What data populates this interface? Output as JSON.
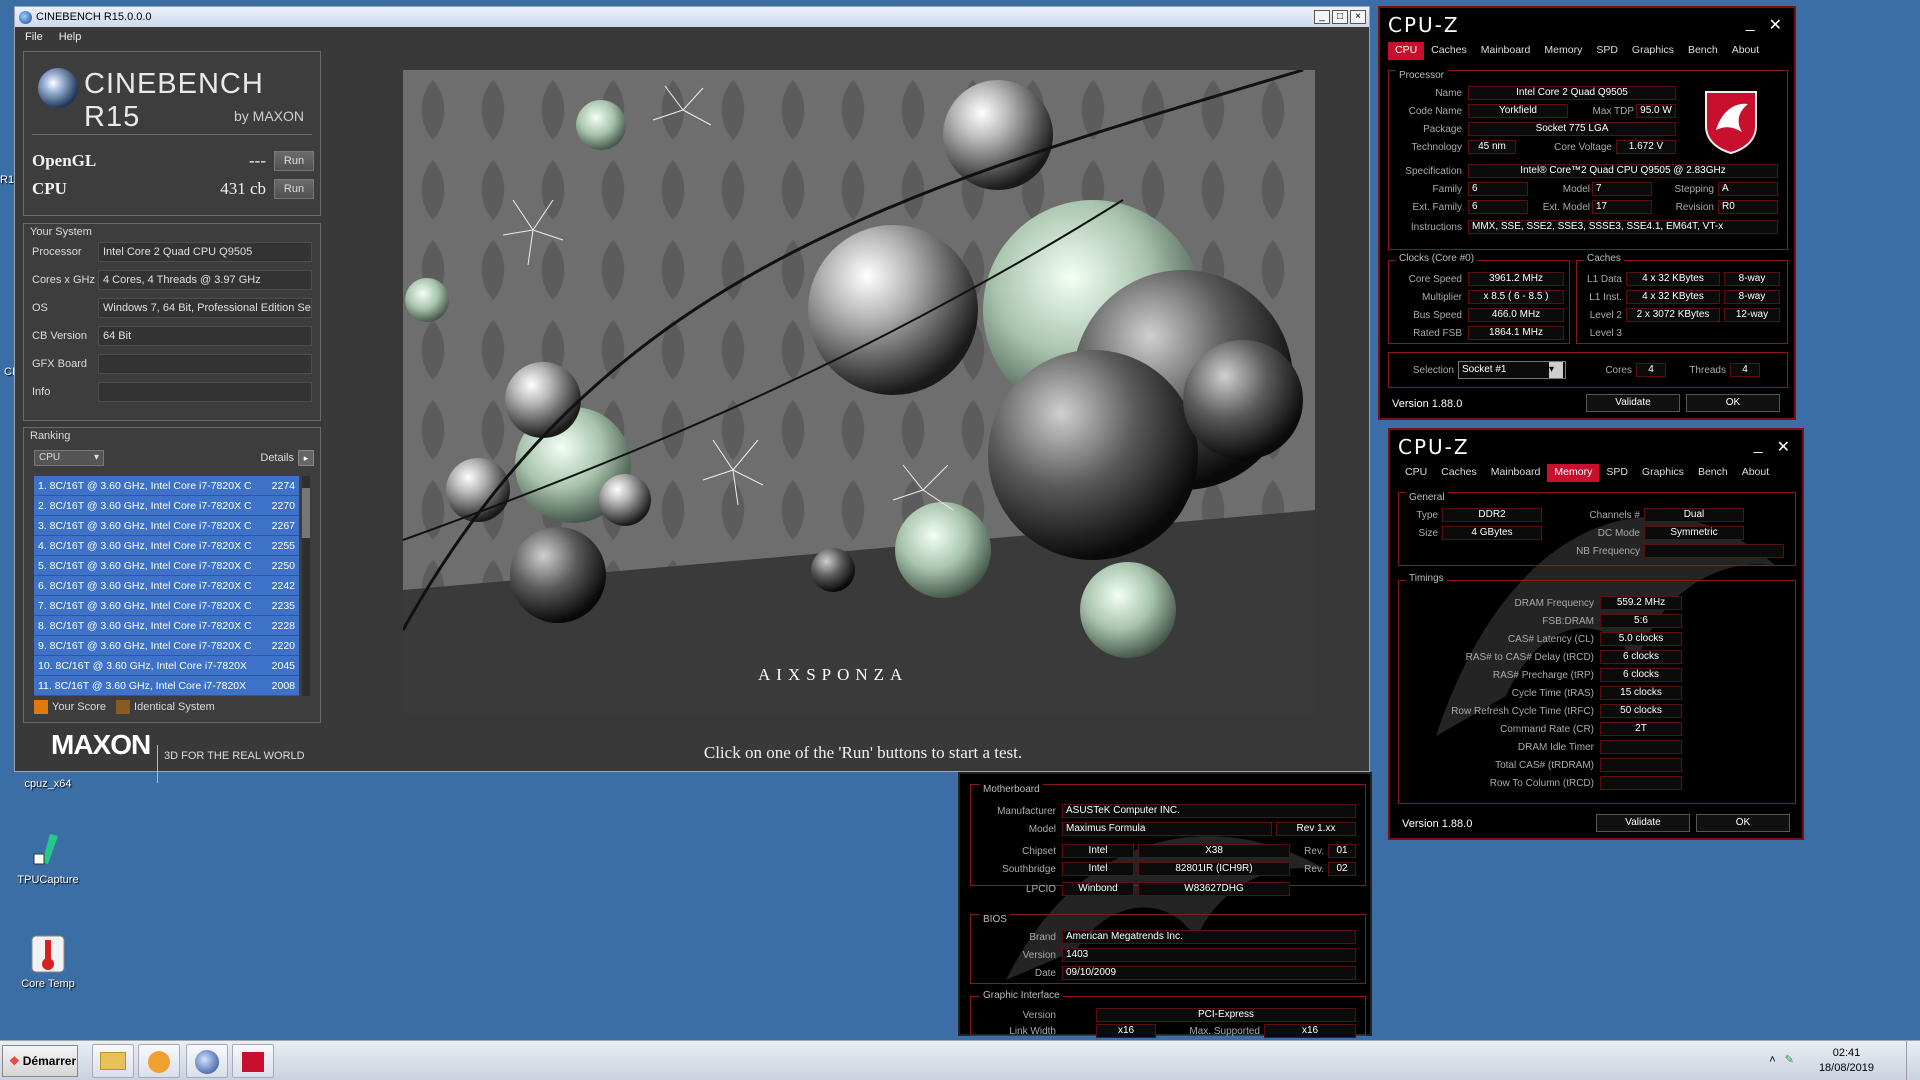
{
  "desktop": {
    "icons": [
      {
        "label": "cpuz_x64"
      },
      {
        "label": "TPUCapture"
      },
      {
        "label": "Core Temp"
      }
    ],
    "edge_labels": [
      "R1",
      "CI"
    ]
  },
  "cinebench": {
    "title": "CINEBENCH R15.0.0.0",
    "menu": [
      "File",
      "Help"
    ],
    "brand": "CINEBENCH R15",
    "brand_by": "by MAXON",
    "opengl": {
      "label": "OpenGL",
      "value": "---",
      "run": "Run"
    },
    "cpu": {
      "label": "CPU",
      "value": "431 cb",
      "run": "Run"
    },
    "system": {
      "title": "Your System",
      "rows": [
        {
          "k": "Processor",
          "v": "Intel Core 2 Quad CPU Q9505"
        },
        {
          "k": "Cores x GHz",
          "v": "4 Cores, 4 Threads @ 3.97 GHz"
        },
        {
          "k": "OS",
          "v": "Windows 7, 64 Bit, Professional Edition Se"
        },
        {
          "k": "CB Version",
          "v": "64 Bit"
        },
        {
          "k": "GFX Board",
          "v": ""
        },
        {
          "k": "Info",
          "v": ""
        }
      ]
    },
    "ranking": {
      "title": "Ranking",
      "select": "CPU",
      "details": "Details",
      "items": [
        {
          "label": "1. 8C/16T @ 3.60 GHz, Intel Core i7-7820X C",
          "value": "2274"
        },
        {
          "label": "2. 8C/16T @ 3.60 GHz, Intel Core i7-7820X C",
          "value": "2270"
        },
        {
          "label": "3. 8C/16T @ 3.60 GHz, Intel Core i7-7820X C",
          "value": "2267"
        },
        {
          "label": "4. 8C/16T @ 3.60 GHz, Intel Core i7-7820X C",
          "value": "2255"
        },
        {
          "label": "5. 8C/16T @ 3.60 GHz, Intel Core i7-7820X C",
          "value": "2250"
        },
        {
          "label": "6. 8C/16T @ 3.60 GHz, Intel Core i7-7820X C",
          "value": "2242"
        },
        {
          "label": "7. 8C/16T @ 3.60 GHz, Intel Core i7-7820X C",
          "value": "2235"
        },
        {
          "label": "8. 8C/16T @ 3.60 GHz, Intel Core i7-7820X C",
          "value": "2228"
        },
        {
          "label": "9. 8C/16T @ 3.60 GHz, Intel Core i7-7820X C",
          "value": "2220"
        },
        {
          "label": "10. 8C/16T @ 3.60 GHz, Intel Core i7-7820X",
          "value": "2045"
        },
        {
          "label": "11. 8C/16T @ 3.60 GHz, Intel Core i7-7820X",
          "value": "2008"
        }
      ],
      "legend_your_score": "Your Score",
      "legend_identical": "Identical System",
      "colors": {
        "your_score": "#e07a10",
        "identical": "#8a5a20",
        "row": "#3e72c9"
      }
    },
    "render_credit": "AIXSPONZA",
    "footer_logo": "MAXON",
    "footer_slogan": "3D FOR THE REAL WORLD",
    "status": "Click on one of the 'Run' buttons to start a test."
  },
  "cpuz_cpu": {
    "logo": "CPU-Z",
    "tabs": [
      "CPU",
      "Caches",
      "Mainboard",
      "Memory",
      "SPD",
      "Graphics",
      "Bench",
      "About"
    ],
    "active_tab": "CPU",
    "processor_label": "Processor",
    "name_k": "Name",
    "name": "Intel Core 2 Quad Q9505",
    "codename_k": "Code Name",
    "codename": "Yorkfield",
    "maxtdp_k": "Max TDP",
    "maxtdp": "95.0 W",
    "package_k": "Package",
    "package": "Socket 775 LGA",
    "tech_k": "Technology",
    "tech": "45 nm",
    "voltage_k": "Core Voltage",
    "voltage": "1.672 V",
    "spec_k": "Specification",
    "spec": "Intel® Core™2 Quad CPU   Q9505  @ 2.83GHz",
    "family_k": "Family",
    "family": "6",
    "model_k": "Model",
    "model": "7",
    "stepping_k": "Stepping",
    "stepping": "A",
    "extfamily_k": "Ext. Family",
    "extfamily": "6",
    "extmodel_k": "Ext. Model",
    "extmodel": "17",
    "revision_k": "Revision",
    "revision": "R0",
    "instr_k": "Instructions",
    "instr": "MMX, SSE, SSE2, SSE3, SSSE3, SSE4.1, EM64T, VT-x",
    "clocks_label": "Clocks (Core #0)",
    "corespeed_k": "Core Speed",
    "corespeed": "3961.2 MHz",
    "mult_k": "Multiplier",
    "mult": "x 8.5 ( 6 - 8.5 )",
    "bus_k": "Bus Speed",
    "bus": "466.0 MHz",
    "fsb_k": "Rated FSB",
    "fsb": "1864.1 MHz",
    "caches_label": "Caches",
    "l1d_k": "L1 Data",
    "l1d": "4 x 32 KBytes",
    "l1d_w": "8-way",
    "l1i_k": "L1 Inst.",
    "l1i": "4 x 32 KBytes",
    "l1i_w": "8-way",
    "l2_k": "Level 2",
    "l2": "2 x 3072 KBytes",
    "l2_w": "12-way",
    "l3_k": "Level 3",
    "selection_k": "Selection",
    "selection": "Socket #1",
    "cores_k": "Cores",
    "cores": "4",
    "threads_k": "Threads",
    "threads": "4",
    "version": "Version 1.88.0",
    "validate": "Validate",
    "ok": "OK"
  },
  "cpuz_mem": {
    "logo": "CPU-Z",
    "tabs": [
      "CPU",
      "Caches",
      "Mainboard",
      "Memory",
      "SPD",
      "Graphics",
      "Bench",
      "About"
    ],
    "active_tab": "Memory",
    "general_label": "General",
    "type_k": "Type",
    "type": "DDR2",
    "size_k": "Size",
    "size": "4 GBytes",
    "channels_k": "Channels #",
    "channels": "Dual",
    "dcmode_k": "DC Mode",
    "dcmode": "Symmetric",
    "nbfreq_k": "NB Frequency",
    "timings_label": "Timings",
    "timings": [
      {
        "k": "DRAM Frequency",
        "v": "559.2 MHz"
      },
      {
        "k": "FSB:DRAM",
        "v": "5:6"
      },
      {
        "k": "CAS# Latency (CL)",
        "v": "5.0 clocks"
      },
      {
        "k": "RAS# to CAS# Delay (tRCD)",
        "v": "6 clocks"
      },
      {
        "k": "RAS# Precharge (tRP)",
        "v": "6 clocks"
      },
      {
        "k": "Cycle Time (tRAS)",
        "v": "15 clocks"
      },
      {
        "k": "Row Refresh Cycle Time (tRFC)",
        "v": "50 clocks"
      },
      {
        "k": "Command Rate (CR)",
        "v": "2T"
      },
      {
        "k": "DRAM Idle Timer",
        "v": ""
      },
      {
        "k": "Total CAS# (tRDRAM)",
        "v": ""
      },
      {
        "k": "Row To Column (tRCD)",
        "v": ""
      }
    ],
    "version": "Version 1.88.0",
    "validate": "Validate",
    "ok": "OK"
  },
  "cpuz_mb": {
    "motherboard_label": "Motherboard",
    "manu_k": "Manufacturer",
    "manu": "ASUSTeK Computer INC.",
    "model_k": "Model",
    "model": "Maximus Formula",
    "model_rev": "Rev 1.xx",
    "chipset_k": "Chipset",
    "chipset_v": "Intel",
    "chipset_m": "X38",
    "chipset_rev_k": "Rev.",
    "chipset_rev": "01",
    "south_k": "Southbridge",
    "south_v": "Intel",
    "south_m": "82801IR (ICH9R)",
    "south_rev_k": "Rev.",
    "south_rev": "02",
    "lpcio_k": "LPCIO",
    "lpcio_v": "Winbond",
    "lpcio_m": "W83627DHG",
    "bios_label": "BIOS",
    "brand_k": "Brand",
    "brand": "American Megatrends Inc.",
    "version_k": "Version",
    "version": "1403",
    "date_k": "Date",
    "date": "09/10/2009",
    "gi_label": "Graphic Interface",
    "giver_k": "Version",
    "giver": "PCI-Express",
    "lw_k": "Link Width",
    "lw": "x16",
    "ms_k": "Max. Supported",
    "ms": "x16"
  },
  "taskbar": {
    "start": "Démarrer",
    "time": "02:41",
    "date": "18/08/2019"
  }
}
